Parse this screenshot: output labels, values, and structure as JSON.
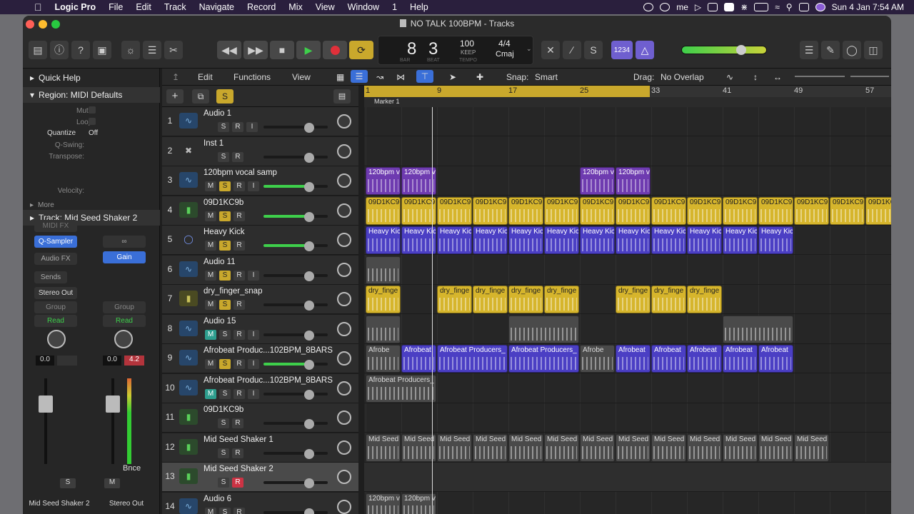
{
  "menubar": {
    "app": "Logic Pro",
    "items": [
      "File",
      "Edit",
      "Track",
      "Navigate",
      "Record",
      "Mix",
      "View",
      "Window",
      "1",
      "Help"
    ],
    "clock": "Sun 4 Jan  7:54 AM"
  },
  "window": {
    "title": "NO TALK 100BPM - Tracks"
  },
  "lcd": {
    "bar": "8",
    "beat": "3",
    "bar_label": "BAR",
    "beat_label": "BEAT",
    "tempo": "100",
    "tempo_sub": "KEEP",
    "tempo_label": "TEMPO",
    "sig": "4/4",
    "key": "Cmaj",
    "count_in": "1234"
  },
  "inspector": {
    "quick_help": "Quick Help",
    "region": "Region: MIDI Defaults",
    "params": [
      "Mute:",
      "Loop:",
      "Q-Swing:",
      "Transpose:",
      "Velocity:"
    ],
    "quantize_label": "Quantize",
    "quantize_value": "Off",
    "more": "More",
    "track": "Track:  Mid Seed Shaker 2",
    "left_strip": {
      "midi_fx": "MIDI FX",
      "instrument": "Q-Sampler",
      "audio_fx": "Audio FX",
      "sends": "Sends",
      "output": "Stereo Out",
      "group": "Group",
      "auto": "Read",
      "vol": "0.0",
      "name": "Mid Seed Shaker 2",
      "solo": "S"
    },
    "right_strip": {
      "plugin": "Gain",
      "group": "Group",
      "auto": "Read",
      "vol": "0.0",
      "peak": "4.2",
      "bounce": "Bnce",
      "mute": "M",
      "name": "Stereo Out"
    }
  },
  "area_header": {
    "edit": "Edit",
    "functions": "Functions",
    "view": "View",
    "snap_label": "Snap:",
    "snap": "Smart",
    "drag_label": "Drag:",
    "drag": "No Overlap"
  },
  "ruler": {
    "marks": [
      "1",
      "9",
      "17",
      "25",
      "33",
      "41",
      "49",
      "57"
    ],
    "marker": "Marker 1"
  },
  "colors": {
    "yellow": "#d6b52c",
    "purple": "#4b3fc4",
    "teal": "#2d9e8e",
    "red": "#cc3344"
  },
  "tracks": [
    {
      "num": "1",
      "name": "Audio 1",
      "type": "audio",
      "btns": [
        "S",
        "R",
        "I"
      ],
      "sel": false
    },
    {
      "num": "2",
      "name": "Inst 1",
      "type": "inst",
      "btns": [
        "S",
        "R"
      ],
      "sel": false
    },
    {
      "num": "3",
      "name": "120bpm vocal samp",
      "type": "audio",
      "btns": [
        "M",
        "S",
        "R",
        "I"
      ],
      "sel": false
    },
    {
      "num": "4",
      "name": "09D1KC9b",
      "type": "green",
      "btns": [
        "M",
        "S",
        "R"
      ],
      "sel": false
    },
    {
      "num": "5",
      "name": "Heavy Kick",
      "type": "drummer",
      "btns": [
        "M",
        "S",
        "R"
      ],
      "sel": false
    },
    {
      "num": "6",
      "name": "Audio 11",
      "type": "audio",
      "btns": [
        "M",
        "S",
        "R",
        "I"
      ],
      "sel": false
    },
    {
      "num": "7",
      "name": "dry_finger_snap",
      "type": "olive",
      "btns": [
        "M",
        "S",
        "R"
      ],
      "sel": false
    },
    {
      "num": "8",
      "name": "Audio 15",
      "type": "audio",
      "btns": [
        "M",
        "S",
        "R",
        "I"
      ],
      "sel": false
    },
    {
      "num": "9",
      "name": "Afrobeat Produc...102BPM_8BARS",
      "type": "audio",
      "btns": [
        "M",
        "S",
        "R",
        "I"
      ],
      "sel": false
    },
    {
      "num": "10",
      "name": "Afrobeat Produc...102BPM_8BARS",
      "type": "audio",
      "btns": [
        "M",
        "S",
        "R",
        "I"
      ],
      "sel": false
    },
    {
      "num": "11",
      "name": "09D1KC9b",
      "type": "green",
      "btns": [
        "S",
        "R"
      ],
      "sel": false
    },
    {
      "num": "12",
      "name": "Mid Seed Shaker 1",
      "type": "green",
      "btns": [
        "S",
        "R"
      ],
      "sel": false
    },
    {
      "num": "13",
      "name": "Mid Seed Shaker 2",
      "type": "green",
      "btns": [
        "S",
        "R"
      ],
      "sel": true
    },
    {
      "num": "14",
      "name": "Audio 6",
      "type": "audio",
      "btns": [
        "M",
        "S",
        "R"
      ],
      "sel": false
    }
  ],
  "regions": [
    {
      "lane": 2,
      "bar": 1,
      "len": 4,
      "color": "pvoc",
      "label": "120bpm v"
    },
    {
      "lane": 2,
      "bar": 5,
      "len": 4,
      "color": "pvoc",
      "label": "120bpm v"
    },
    {
      "lane": 2,
      "bar": 25,
      "len": 4,
      "color": "pvoc",
      "label": "120bpm v"
    },
    {
      "lane": 2,
      "bar": 29,
      "len": 4,
      "color": "pvoc",
      "label": "120bpm v"
    },
    {
      "lane": 3,
      "bar": 1,
      "len": 59,
      "color": "yel",
      "label": "09D1KC9",
      "repeat": 4
    },
    {
      "lane": 4,
      "bar": 1,
      "len": 48,
      "color": "pur",
      "label": "Heavy Kic",
      "repeat": 4
    },
    {
      "lane": 5,
      "bar": 1,
      "len": 4,
      "color": "gry",
      "label": ""
    },
    {
      "lane": 6,
      "bar": 1,
      "len": 4,
      "color": "yel",
      "label": "dry_finge"
    },
    {
      "lane": 6,
      "bar": 9,
      "len": 16,
      "color": "yel",
      "label": "dry_finge",
      "repeat": 4
    },
    {
      "lane": 6,
      "bar": 29,
      "len": 12,
      "color": "yel",
      "label": "dry_finge",
      "repeat": 4
    },
    {
      "lane": 7,
      "bar": 1,
      "len": 4,
      "color": "gry",
      "label": ""
    },
    {
      "lane": 7,
      "bar": 17,
      "len": 8,
      "color": "gry",
      "label": ""
    },
    {
      "lane": 7,
      "bar": 41,
      "len": 8,
      "color": "gry",
      "label": ""
    },
    {
      "lane": 8,
      "bar": 1,
      "len": 4,
      "color": "gry",
      "label": "Afrobe"
    },
    {
      "lane": 8,
      "bar": 5,
      "len": 4,
      "color": "pur",
      "label": "Afrobeat"
    },
    {
      "lane": 8,
      "bar": 9,
      "len": 8,
      "color": "pur",
      "label": "Afrobeat Producers_"
    },
    {
      "lane": 8,
      "bar": 17,
      "len": 8,
      "color": "pur",
      "label": "Afrobeat Producers_"
    },
    {
      "lane": 8,
      "bar": 25,
      "len": 4,
      "color": "gry",
      "label": "Afrobe"
    },
    {
      "lane": 8,
      "bar": 29,
      "len": 20,
      "color": "pur",
      "label": "Afrobeat",
      "repeat": 4
    },
    {
      "lane": 9,
      "bar": 1,
      "len": 8,
      "color": "gry",
      "label": "Afrobeat Producers_"
    },
    {
      "lane": 11,
      "bar": 1,
      "len": 52,
      "color": "gry",
      "label": "Mid Seed",
      "repeat": 4
    },
    {
      "lane": 13,
      "bar": 1,
      "len": 4,
      "color": "gry",
      "label": "120bpm v"
    },
    {
      "lane": 13,
      "bar": 5,
      "len": 4,
      "color": "gry",
      "label": "120bpm v"
    }
  ]
}
